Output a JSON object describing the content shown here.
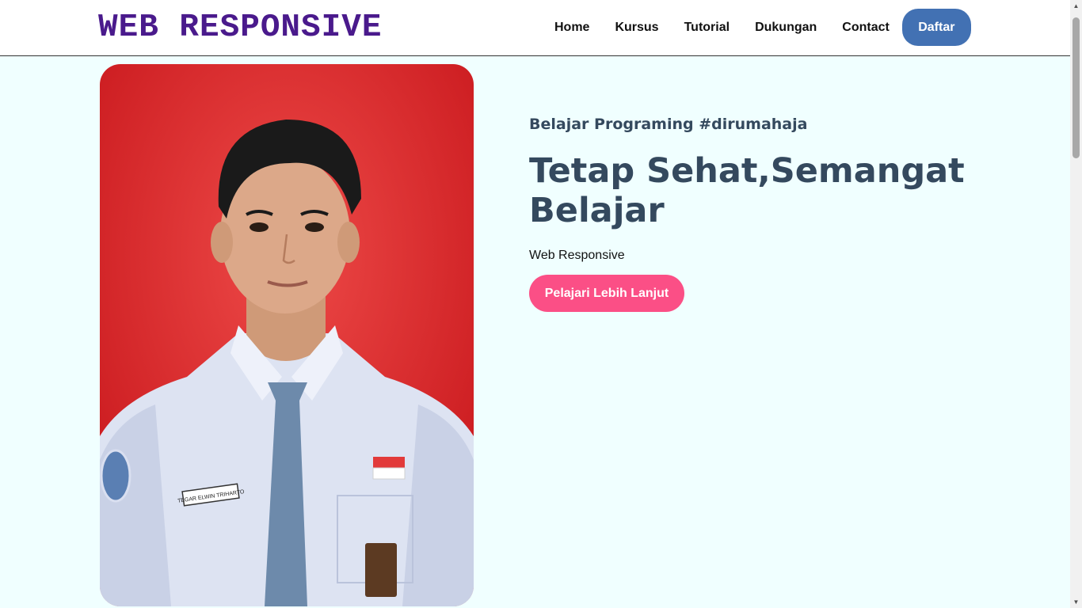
{
  "navbar": {
    "logo": "WEB RESPONSIVE",
    "links": [
      {
        "label": "Home"
      },
      {
        "label": "Kursus"
      },
      {
        "label": "Tutorial"
      },
      {
        "label": "Dukungan"
      },
      {
        "label": "Contact"
      }
    ],
    "cta_label": "Daftar"
  },
  "hero": {
    "subtitle": "Belajar Programing #dirumahaja",
    "headline": "Tetap Sehat,Semangat Belajar",
    "description": "Web Responsive",
    "button_label": "Pelajari Lebih Lanjut",
    "photo": {
      "name_tag": "TEGAR ELWIN TRIHARTO"
    }
  },
  "colors": {
    "logo": "#4a1a8c",
    "page_background": "#f0ffff",
    "daftar_button": "#4271b3",
    "cta_button": "#fb4f86",
    "headline": "#34495e",
    "photo_background": "#e0282c"
  }
}
